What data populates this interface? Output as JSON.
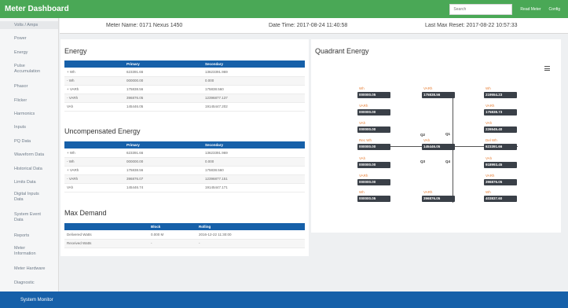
{
  "header": {
    "title": "Meter Dashboard",
    "search_placeholder": "Search",
    "links": [
      "Read Meter",
      "Config"
    ]
  },
  "sidebar": {
    "items": [
      {
        "label": "Volts / Amps"
      },
      {
        "label": "Power"
      },
      {
        "label": "Energy"
      },
      {
        "label": "Pulse Accumulation"
      },
      {
        "label": "Phasor"
      },
      {
        "label": "Flicker"
      },
      {
        "label": "Harmonics"
      },
      {
        "label": "Inputs"
      },
      {
        "label": "PQ Data"
      },
      {
        "label": "Waveform Data"
      },
      {
        "label": "Historical Data"
      },
      {
        "label": "Limits Data"
      },
      {
        "label": "Digital Inputs Data"
      },
      {
        "label": "System Event Data"
      },
      {
        "label": "Reports"
      },
      {
        "label": "Meter Information"
      },
      {
        "label": "Meter Hardware"
      },
      {
        "label": "Diagnostic"
      }
    ]
  },
  "info": {
    "meter_name": "Meter Name: 0171 Nexus 1450",
    "date_time": "Date Time: 2017-08-24 11:40:58",
    "last_reset": "Last Max Reset: 2017-08-22 10:57:33"
  },
  "energy": {
    "title": "Energy",
    "headers": [
      "",
      "Primary",
      "Secondary"
    ],
    "rows": [
      [
        "+ Wh",
        "623391.66",
        "13623391.969"
      ],
      [
        "- Wh",
        "000000.00",
        "0.000"
      ],
      [
        "+ VARh",
        "175838.56",
        "175838.560"
      ],
      [
        "- VARh",
        "396876.05",
        "12396877.137"
      ],
      [
        "VAh",
        "145446.05",
        "19145447.202"
      ]
    ]
  },
  "uncompensated": {
    "title": "Uncompensated Energy",
    "headers": [
      "",
      "Primary",
      "Secondary"
    ],
    "rows": [
      [
        "+ Wh",
        "623391.66",
        "13623391.969"
      ],
      [
        "- Wh",
        "000000.00",
        "0.000"
      ],
      [
        "+ VARh",
        "175838.56",
        "175838.560"
      ],
      [
        "- VARh",
        "396876.07",
        "12396877.151"
      ],
      [
        "VAh",
        "145446.74",
        "19145447.171"
      ]
    ]
  },
  "max_demand": {
    "title": "Max Demand",
    "headers": [
      "",
      "Block",
      "Rolling"
    ],
    "rows": [
      [
        "Delivered Watts",
        "0.000 M",
        "2016-12-22 11:30:00"
      ],
      [
        "Received Watts",
        "-",
        "-"
      ]
    ]
  },
  "quadrant": {
    "title": "Quadrant Energy",
    "quadrants": [
      "Q2",
      "Q1",
      "Q3",
      "Q4"
    ],
    "cells": [
      {
        "label": "Wh",
        "value": "000000.05"
      },
      {
        "label": "VARh",
        "value": "175838.56"
      },
      {
        "label": "Wh",
        "value": "219554.23"
      },
      {
        "label": "VARh",
        "value": "000000.00"
      },
      {
        "label": "VARh",
        "value": "175838.73"
      },
      {
        "label": "VAh",
        "value": "000000.00"
      },
      {
        "label": "VAh",
        "value": "226545.40"
      },
      {
        "label": "Rec Wh",
        "value": "000000.00"
      },
      {
        "label": "VAh",
        "value": "145446.05"
      },
      {
        "label": "Del Wh",
        "value": "623391.66"
      },
      {
        "label": "VAh",
        "value": "000000.00"
      },
      {
        "label": "VAh",
        "value": "918993.45"
      },
      {
        "label": "VARh",
        "value": "000000.00"
      },
      {
        "label": "VARh",
        "value": "396876.05"
      },
      {
        "label": "Wh",
        "value": "000000.05"
      },
      {
        "label": "VARh",
        "value": "396876.05"
      },
      {
        "label": "Wh",
        "value": "403837.60"
      }
    ]
  },
  "footer": {
    "label": "System Monitor"
  }
}
